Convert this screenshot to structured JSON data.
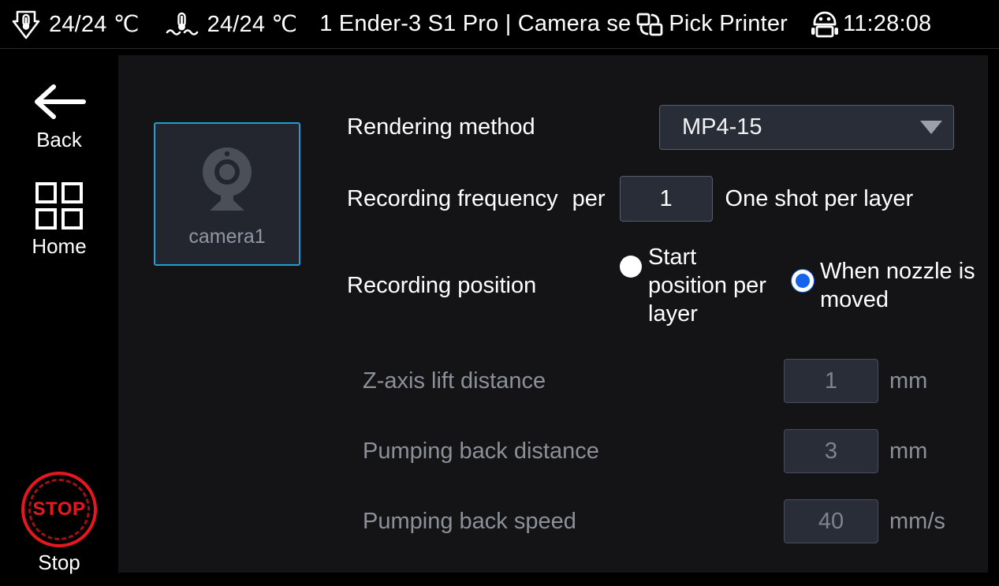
{
  "topbar": {
    "nozzle_icon": "nozzle-temperature-icon",
    "nozzle_temp": "24/24 ℃",
    "bed_icon": "bed-temperature-icon",
    "bed_temp": "24/24 ℃",
    "printer_title": "1 Ender-3 S1 Pro | Camera se",
    "pick_printer_icon": "switch-printer-icon",
    "pick_printer_label": "Pick Printer",
    "robot_icon": "robot-icon",
    "clock": "11:28:08"
  },
  "sidebar": {
    "items": [
      {
        "name": "back",
        "label": "Back",
        "icon": "arrow-left-icon"
      },
      {
        "name": "home",
        "label": "Home",
        "icon": "grid-icon"
      },
      {
        "name": "stop",
        "label": "Stop",
        "icon": "stop-icon",
        "badge": "STOP",
        "color": "#e8161f"
      }
    ]
  },
  "main": {
    "cameras": [
      {
        "name": "camera1",
        "label": "camera1",
        "icon": "webcam-icon",
        "selected": true
      }
    ],
    "rendering": {
      "label": "Rendering method",
      "value": "MP4-15",
      "caret_icon": "chevron-down-icon"
    },
    "frequency": {
      "label": "Recording frequency",
      "per_label": "per",
      "value": "1",
      "suffix": "One shot per layer"
    },
    "position": {
      "label": "Recording position",
      "options": [
        {
          "label": "Start position per layer",
          "selected": false
        },
        {
          "label": "When nozzle is moved",
          "selected": true
        }
      ]
    },
    "advanced": [
      {
        "label": "Z-axis lift distance",
        "value": "1",
        "unit": "mm",
        "disabled": true
      },
      {
        "label": "Pumping back distance",
        "value": "3",
        "unit": "mm",
        "disabled": true
      },
      {
        "label": "Pumping back speed",
        "value": "40",
        "unit": "mm/s",
        "disabled": true
      }
    ]
  },
  "colors": {
    "accent": "#1d9fd4",
    "radio_selected": "#1565ec",
    "stop_red": "#e8161f",
    "panel_bg": "#141416",
    "field_bg": "#282d38"
  }
}
